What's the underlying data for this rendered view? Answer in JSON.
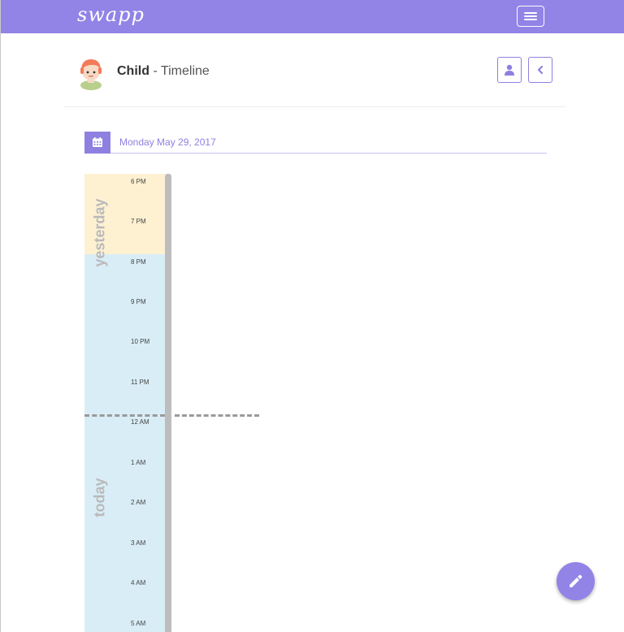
{
  "navbar": {
    "brand": "swapp",
    "menu_icon": "hamburger-icon",
    "color": "#9283e6"
  },
  "header": {
    "avatar_icon": "child-avatar-icon",
    "title_bold": "Child",
    "title_rest": " - Timeline",
    "profile_icon": "user-icon",
    "back_icon": "chevron-left-icon"
  },
  "date_bar": {
    "calendar_icon": "calendar-icon",
    "date": "Monday May 29, 2017"
  },
  "timeline": {
    "yesterday_label": "yesterday",
    "today_label": "today",
    "hours": [
      "6 PM",
      "7 PM",
      "8 PM",
      "9 PM",
      "10 PM",
      "11 PM",
      "12 AM",
      "1 AM",
      "2 AM",
      "3 AM",
      "4 AM",
      "5 AM"
    ],
    "yesterday_color": "#fdf1d2",
    "today_color": "#d9edf6"
  },
  "fab": {
    "icon": "pencil-icon"
  }
}
